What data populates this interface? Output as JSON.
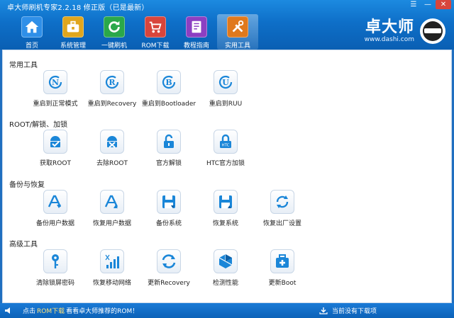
{
  "window": {
    "title": "卓大师刷机专家2.2.18 修正版（已是最新）",
    "controls": [
      "☰",
      "—",
      "✕"
    ]
  },
  "toolbar": [
    {
      "label": "首页",
      "icon": "home-icon",
      "color": "#2f8fe8"
    },
    {
      "label": "系统管理",
      "icon": "toolbox-icon",
      "color": "#e0a61d"
    },
    {
      "label": "一键刷机",
      "icon": "refresh-icon",
      "color": "#2aa84a"
    },
    {
      "label": "ROM下载",
      "icon": "cart-icon",
      "color": "#d8453c"
    },
    {
      "label": "教程指南",
      "icon": "notebook-icon",
      "color": "#8c3fc2"
    },
    {
      "label": "实用工具",
      "icon": "tools-icon",
      "color": "#e0791d"
    }
  ],
  "brand": {
    "name": "卓大师",
    "url": "www.dashi.com"
  },
  "sections": [
    {
      "title": "常用工具",
      "items": [
        {
          "label": "重启到正常模式",
          "icon": "reboot-normal-icon"
        },
        {
          "label": "重启到Recovery",
          "icon": "reboot-recovery-icon"
        },
        {
          "label": "重启到Bootloader",
          "icon": "reboot-bootloader-icon"
        },
        {
          "label": "重启到RUU",
          "icon": "reboot-ruu-icon"
        }
      ]
    },
    {
      "title": "ROOT/解锁、加锁",
      "items": [
        {
          "label": "获取ROOT",
          "icon": "android-check-icon"
        },
        {
          "label": "去除ROOT",
          "icon": "android-remove-icon"
        },
        {
          "label": "官方解锁",
          "icon": "unlock-icon"
        },
        {
          "label": "HTC官方加锁",
          "icon": "htc-lock-icon",
          "icon_text": "HTC"
        }
      ]
    },
    {
      "title": "备份与恢复",
      "items": [
        {
          "label": "备份用户数据",
          "icon": "backup-data-icon"
        },
        {
          "label": "恢复用户数据",
          "icon": "restore-data-icon"
        },
        {
          "label": "备份系统",
          "icon": "save-system-icon"
        },
        {
          "label": "恢复系统",
          "icon": "restore-system-icon"
        },
        {
          "label": "恢复出厂设置",
          "icon": "factory-reset-icon"
        }
      ]
    },
    {
      "title": "高级工具",
      "items": [
        {
          "label": "清除锁屏密码",
          "icon": "key-icon"
        },
        {
          "label": "恢复移动网络",
          "icon": "signal-icon"
        },
        {
          "label": "更新Recovery",
          "icon": "update-recovery-icon"
        },
        {
          "label": "检测性能",
          "icon": "performance-icon"
        },
        {
          "label": "更新Boot",
          "icon": "medkit-icon"
        }
      ]
    }
  ],
  "statusbar": {
    "prefix": "点击",
    "link": "ROM下载",
    "suffix": "看看卓大师推荐的ROM！",
    "download_status": "当前没有下载项"
  },
  "colors": {
    "primary": "#0e6fc8",
    "accent_icon": "#1a86d8"
  }
}
